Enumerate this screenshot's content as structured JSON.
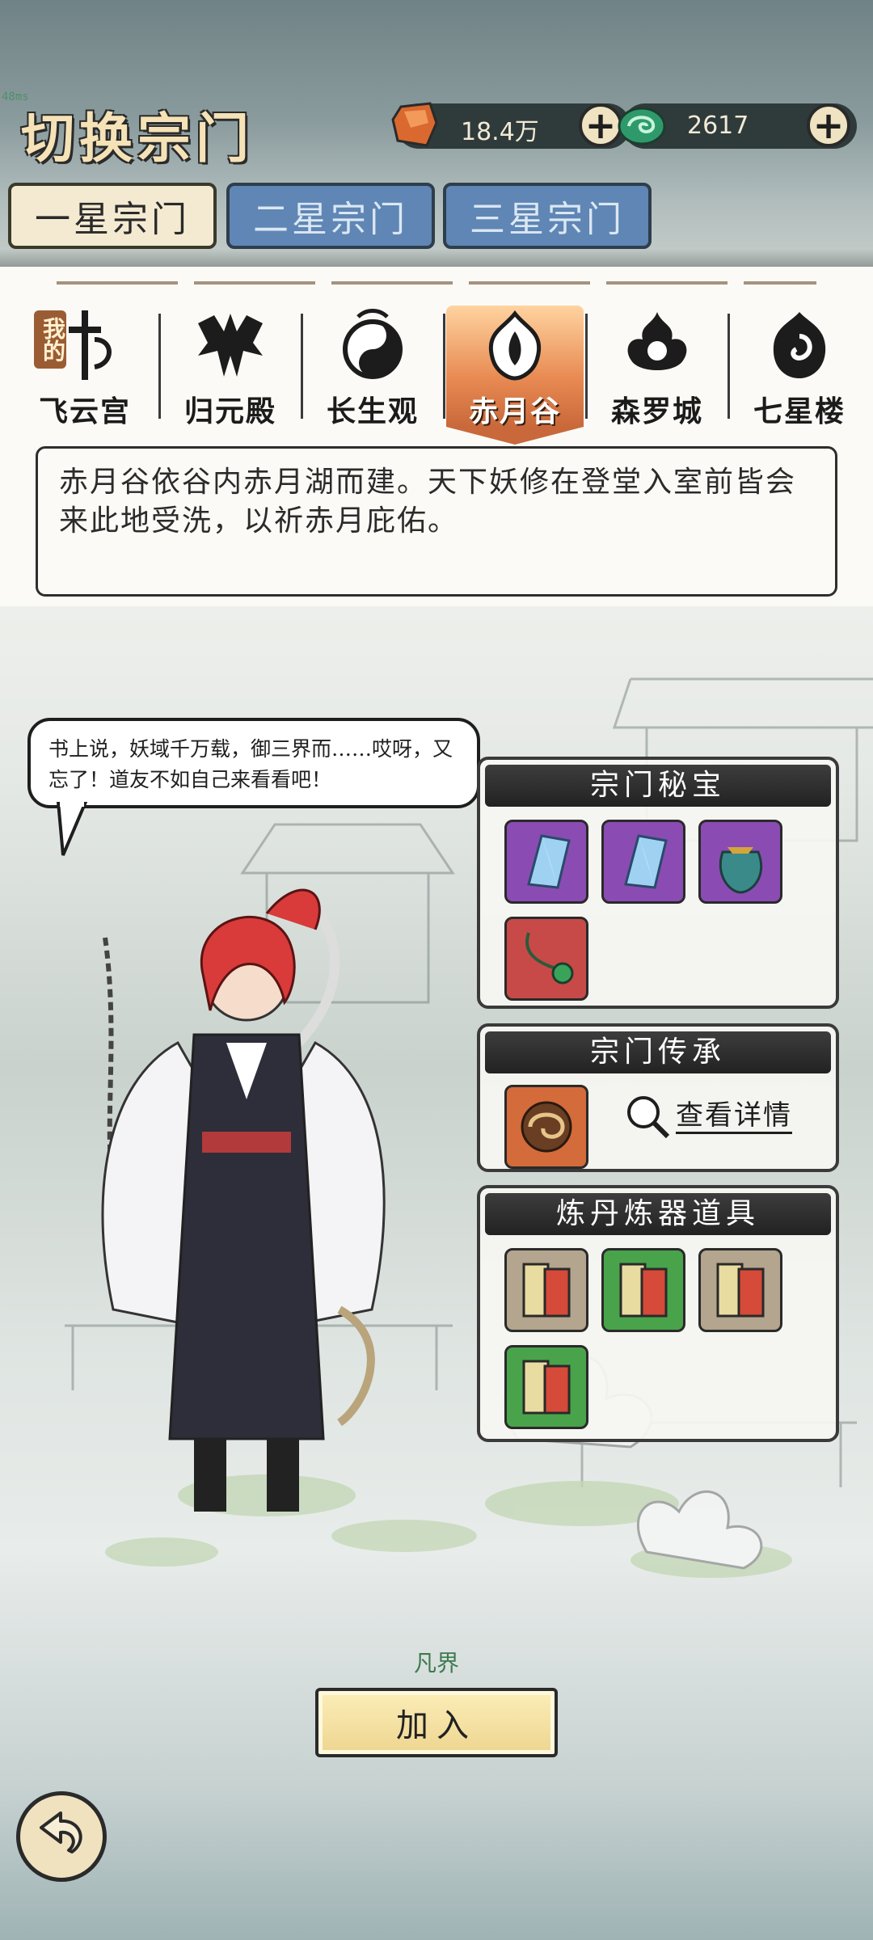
{
  "debug": {
    "fps_label": "48ms"
  },
  "header": {
    "title": "切换宗门",
    "currencies": [
      {
        "icon": "spirit-stone-icon",
        "value": "18.4万"
      },
      {
        "icon": "jade-swirl-icon",
        "value": "2617"
      }
    ],
    "plus_label": "+"
  },
  "tier_tabs": [
    {
      "label": "一星宗门",
      "active": true
    },
    {
      "label": "二星宗门",
      "active": false
    },
    {
      "label": "三星宗门",
      "active": false
    }
  ],
  "sects": [
    {
      "name": "飞云宫",
      "badge": "我的",
      "icon": "sword-emblem-icon"
    },
    {
      "name": "归元殿",
      "icon": "spiky-crest-icon"
    },
    {
      "name": "长生观",
      "icon": "yin-yang-icon"
    },
    {
      "name": "赤月谷",
      "icon": "flame-crescent-icon",
      "active": true
    },
    {
      "name": "森罗城",
      "icon": "dark-flame-icon"
    },
    {
      "name": "七星楼",
      "icon": "swirl-flame-icon"
    }
  ],
  "description": "赤月谷依谷内赤月湖而建。天下妖修在登堂入室前皆会来此地受洗，以祈赤月庇佑。",
  "speech": "书上说，妖域千万载，御三界而……哎呀，又忘了！道友不如自己来看看吧！",
  "cards": {
    "treasure": {
      "title": "宗门秘宝"
    },
    "inheritance": {
      "title": "宗门传承",
      "detail_label": "查看详情"
    },
    "alchemy": {
      "title": "炼丹炼器道具"
    }
  },
  "realm_label": "凡界",
  "join_label": "加入",
  "colors": {
    "accent": "#e88a52",
    "tab_inactive": "#5f86b4",
    "title_gold": "#f5e2b6"
  }
}
